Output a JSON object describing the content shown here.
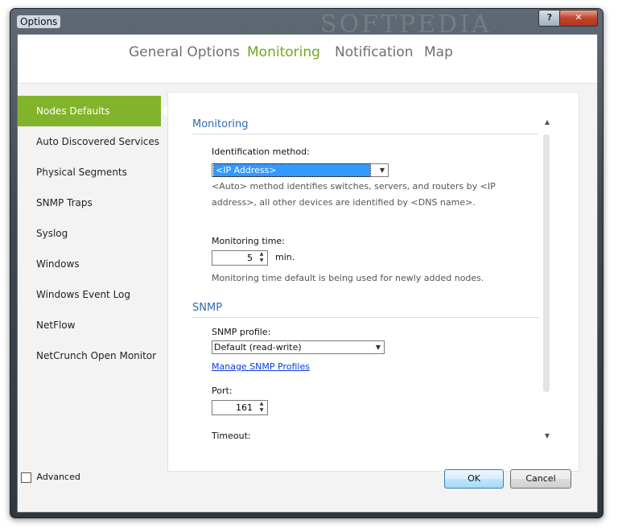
{
  "window": {
    "title": "Options",
    "help_label": "?",
    "close_label": "✕",
    "watermark": "SOFTPEDIA"
  },
  "tabs": [
    {
      "label": "General Options",
      "active": false
    },
    {
      "label": "Monitoring",
      "active": true
    },
    {
      "label": "Notification",
      "active": false
    },
    {
      "label": "Map",
      "active": false
    }
  ],
  "sidebar": {
    "items": [
      {
        "label": "Nodes Defaults",
        "active": true
      },
      {
        "label": "Auto Discovered Services"
      },
      {
        "label": "Physical Segments"
      },
      {
        "label": "SNMP Traps"
      },
      {
        "label": "Syslog"
      },
      {
        "label": "Windows"
      },
      {
        "label": "Windows Event Log"
      },
      {
        "label": "NetFlow"
      },
      {
        "label": "NetCrunch Open Monitor"
      }
    ]
  },
  "monitoring": {
    "section_title": "Monitoring",
    "identification_label": "Identification method:",
    "identification_value": "<IP Address>",
    "identification_desc_line1": "<Auto> method identifies switches, servers, and routers by <IP",
    "identification_desc_line2": "address>, all other devices are identified by <DNS name>.",
    "time_label": "Monitoring time:",
    "time_value": "5",
    "time_unit": "min.",
    "time_desc": "Monitoring time default is being used for newly added nodes."
  },
  "snmp": {
    "section_title": "SNMP",
    "profile_label": "SNMP profile:",
    "profile_value": "Default (read-write)",
    "manage_link": "Manage SNMP Profiles",
    "port_label": "Port:",
    "port_value": "161",
    "timeout_label": "Timeout:"
  },
  "footer": {
    "advanced_label": "Advanced",
    "ok_label": "OK",
    "cancel_label": "Cancel"
  },
  "colors": {
    "accent": "#82b42b",
    "tab_active": "#71a81a",
    "section": "#2d6cb2"
  },
  "icons": {
    "dropdown": "chevron-down-icon",
    "spin_up": "caret-up-icon",
    "spin_down": "caret-down-icon"
  }
}
